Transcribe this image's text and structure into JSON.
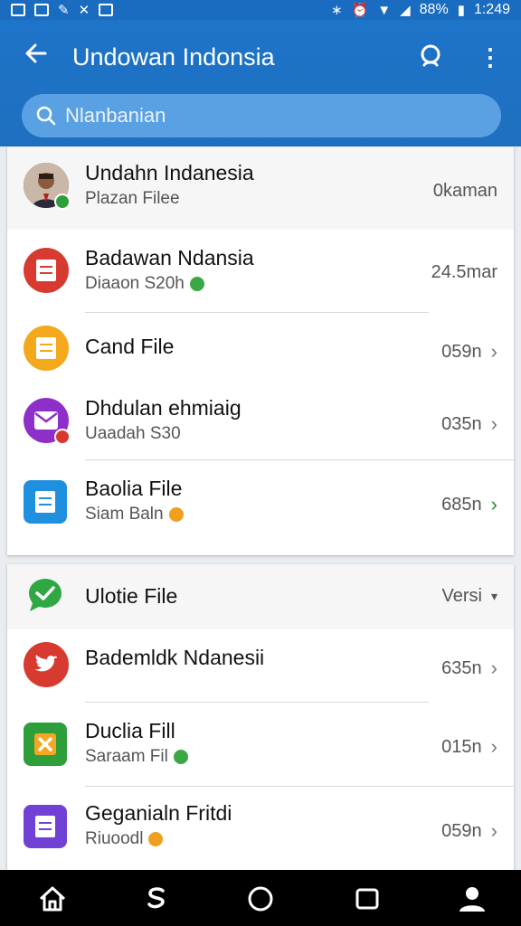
{
  "status": {
    "battery": "88%",
    "time": "1:249"
  },
  "appbar": {
    "title": "Undowan Indonsia"
  },
  "search": {
    "placeholder": "Nlanbanian"
  },
  "list1": [
    {
      "title": "Undahn Indanesia",
      "subtitle": "Plazan Filee",
      "meta": "0kaman"
    },
    {
      "title": "Badawan Ndansia",
      "subtitle": "Diaaon S20h",
      "meta": "24.5mar"
    },
    {
      "title": "Cand File",
      "subtitle": "",
      "meta": "059n"
    },
    {
      "title": "Dhdulan ehmiaig",
      "subtitle": "Uaadah S30",
      "meta": "035n"
    },
    {
      "title": "Baolia File",
      "subtitle": "Siam Baln",
      "meta": "685n"
    }
  ],
  "section2": {
    "header": "Ulotie File",
    "action": "Versi"
  },
  "list2": [
    {
      "title": "Bademldk Ndanesii",
      "subtitle": "",
      "meta": "635n"
    },
    {
      "title": "Duclia Fill",
      "subtitle": "Saraam Fil",
      "meta": "015n"
    },
    {
      "title": "Geganialn Fritdi",
      "subtitle": "Riuoodl",
      "meta": "059n"
    }
  ],
  "colors": {
    "appbar": "#1d74c9",
    "accent_green": "#1f8f2e",
    "search_field": "#5aa1e3"
  },
  "icons": [
    "back-arrow-icon",
    "search-icon",
    "more-vert-icon",
    "home-icon",
    "back-gesture-icon",
    "circle-home-icon",
    "square-recents-icon",
    "person-icon"
  ]
}
